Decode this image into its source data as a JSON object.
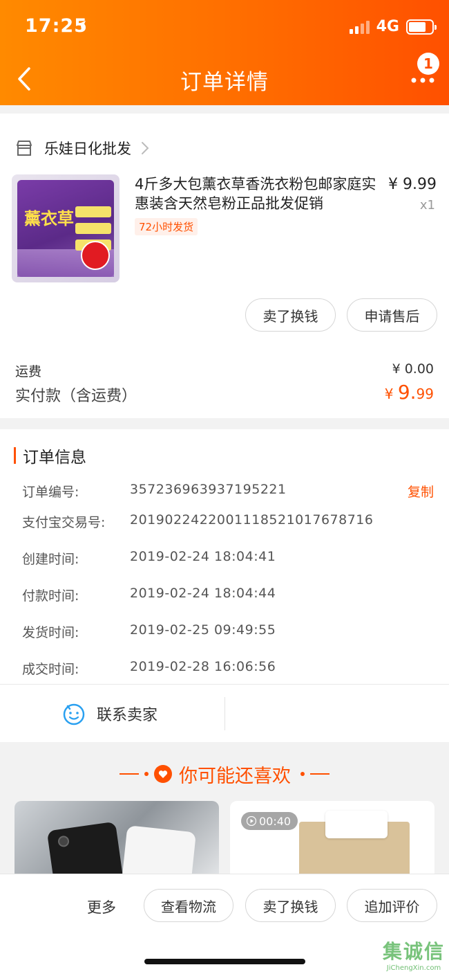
{
  "status": {
    "time": "17:25",
    "network": "4G"
  },
  "header": {
    "title": "订单详情",
    "more_badge": "1"
  },
  "shop": {
    "name": "乐娃日化批发"
  },
  "product": {
    "title": "4斤多大包薰衣草香洗衣粉包邮家庭实惠装含天然皂粉正品批发促销",
    "tag": "72小时发货",
    "price": "¥ 9.99",
    "qty": "x1",
    "image_text": "薰衣草"
  },
  "item_actions": {
    "sell": "卖了换钱",
    "after_sale": "申请售后"
  },
  "totals": {
    "freight_label": "运费",
    "freight_value": "¥ 0.00",
    "paid_label": "实付款（含运费）",
    "paid_currency": "¥ ",
    "paid_int": "9.",
    "paid_dec": "99"
  },
  "order_info": {
    "title": "订单信息",
    "copy_label": "复制",
    "rows": [
      {
        "label": "订单编号:",
        "value": "357236963937195221"
      },
      {
        "label": "支付宝交易号:",
        "value": "2019022422001118521017678716"
      },
      {
        "label": "创建时间:",
        "value": "2019-02-24 18:04:41"
      },
      {
        "label": "付款时间:",
        "value": "2019-02-24 18:04:44"
      },
      {
        "label": "发货时间:",
        "value": "2019-02-25 09:49:55"
      },
      {
        "label": "成交时间:",
        "value": "2019-02-28 16:06:56"
      }
    ]
  },
  "contact": {
    "label": "联系卖家"
  },
  "recommend": {
    "title": "你可能还喜欢",
    "video_duration": "00:40"
  },
  "bottom_bar": {
    "more": "更多",
    "logistics": "查看物流",
    "sell": "卖了换钱",
    "review": "追加评价"
  },
  "watermark": {
    "main": "集诚信",
    "sub": "JiChengXin.com"
  },
  "colors": {
    "accent": "#ff5000",
    "header_start": "#ff8a00",
    "header_end": "#ff5000"
  }
}
